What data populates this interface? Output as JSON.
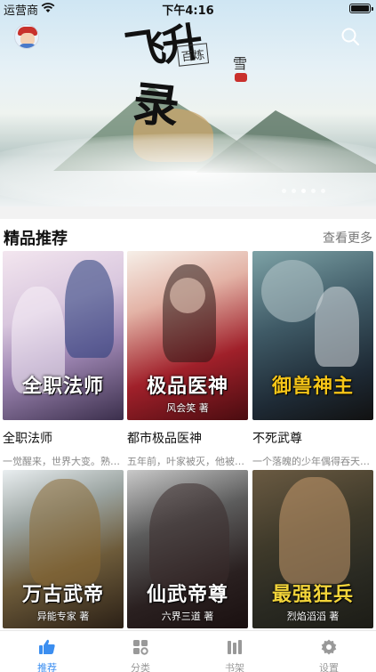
{
  "status_bar": {
    "carrier": "运营商",
    "time": "下午4:16"
  },
  "banner": {
    "title_line1": "飞升",
    "title_line2": "录",
    "seal_text": "百炼",
    "author_text": "雪"
  },
  "section": {
    "title": "精品推荐",
    "more": "查看更多"
  },
  "books": [
    {
      "name": "全职法师",
      "desc": "一觉醒来，世界大变。熟悉的高中传授",
      "cover_title": "全职法师",
      "cover_author": ""
    },
    {
      "name": "都市极品医神",
      "desc": "五年前，叶家被灭，他被迫入赘",
      "cover_title": "极品医神",
      "cover_author": "风会笑 著"
    },
    {
      "name": "不死武尊",
      "desc": "一个落魄的少年偶得吞天魔功",
      "cover_title": "御兽神主",
      "cover_author": ""
    },
    {
      "name": "",
      "desc": "",
      "cover_title": "万古武帝",
      "cover_author": "异能专家 著"
    },
    {
      "name": "",
      "desc": "",
      "cover_title": "仙武帝尊",
      "cover_author": "六界三道 著"
    },
    {
      "name": "",
      "desc": "",
      "cover_title": "最强狂兵",
      "cover_author": "烈焰滔滔 著"
    }
  ],
  "tabs": [
    {
      "label": "推荐",
      "icon": "thumbs-up-icon",
      "active": true
    },
    {
      "label": "分类",
      "icon": "category-icon",
      "active": false
    },
    {
      "label": "书架",
      "icon": "bookshelf-icon",
      "active": false
    },
    {
      "label": "设置",
      "icon": "gear-icon",
      "active": false
    }
  ],
  "colors": {
    "accent": "#3b8ef0",
    "tab_inactive": "#999999"
  }
}
